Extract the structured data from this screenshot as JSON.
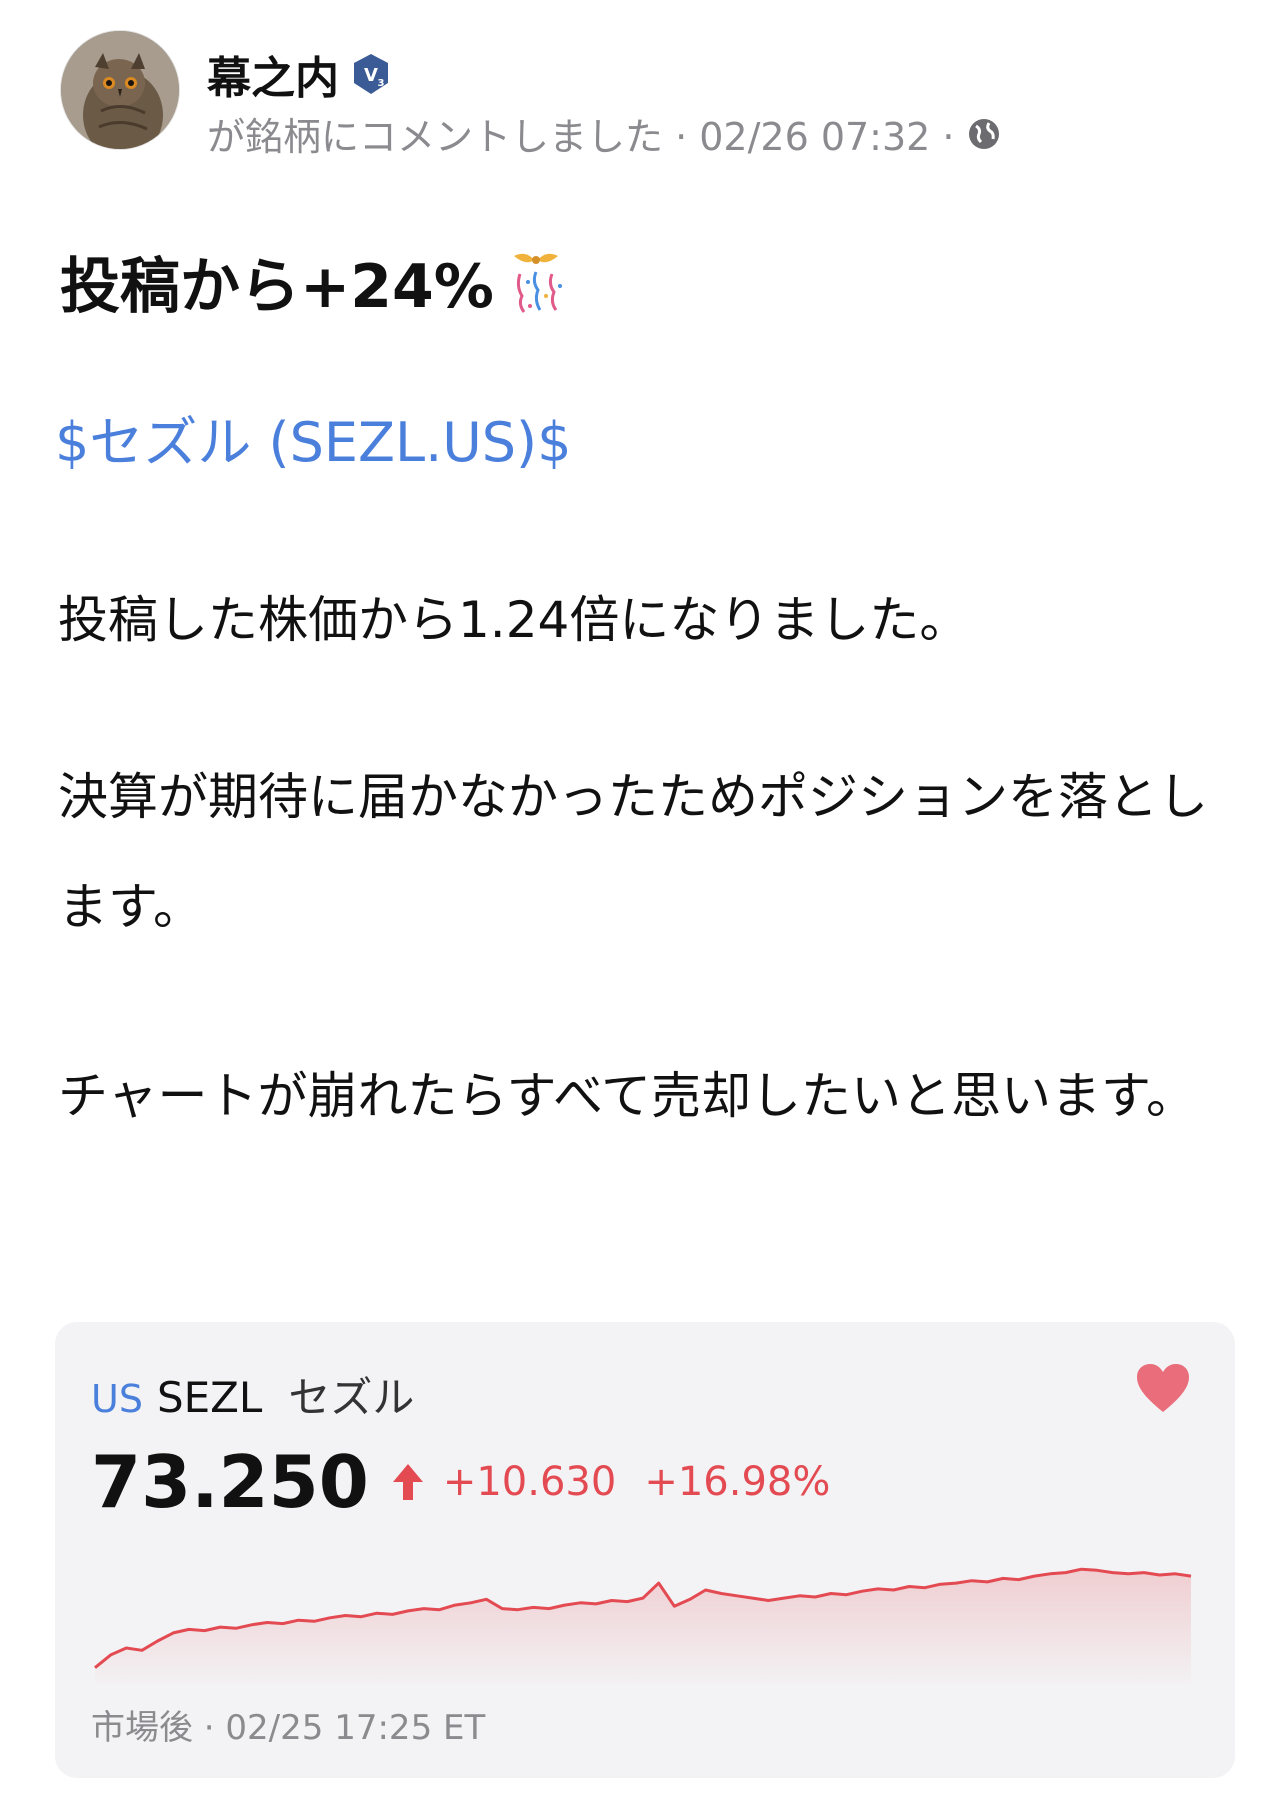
{
  "post": {
    "author": "幕之内",
    "badge_icon": "verified-v3-badge-icon",
    "meta_text": "が銘柄にコメントしました · 02/26 07:32 ·",
    "visibility_icon": "globe-icon",
    "headline": "投稿から+24%",
    "headline_icon": "party-popper-icon",
    "stock_link": "$セズル (SEZL.US)$",
    "paragraphs": [
      "投稿した株価から1.24倍になりました。",
      "決算が期待に届かなかったためポジションを落とします。",
      "チャートが崩れたらすべて売却したいと思います。"
    ]
  },
  "stock_card": {
    "market": "US",
    "symbol": "SEZL",
    "name": "セズル",
    "price": "73.250",
    "change": "+10.630",
    "change_pct": "+16.98%",
    "direction_icon": "up-arrow-icon",
    "favorite_icon": "heart-icon",
    "timestamp": "市場後 · 02/25 17:25 ET",
    "colors": {
      "up": "#e34a52",
      "link": "#4a7fdc",
      "card_bg": "#f3f3f5"
    }
  },
  "chart_data": {
    "type": "line",
    "x": [
      0,
      1,
      2,
      3,
      4,
      5,
      6,
      7,
      8,
      9,
      10,
      11,
      12,
      13,
      14,
      15,
      16,
      17,
      18,
      19,
      20,
      21,
      22,
      23,
      24,
      25,
      26,
      27,
      28,
      29,
      30,
      31,
      32,
      33,
      34,
      35,
      36,
      37,
      38,
      39,
      40,
      41,
      42,
      43,
      44,
      45,
      46,
      47,
      48,
      49,
      50,
      51,
      52,
      53,
      54,
      55,
      56,
      57,
      58,
      59,
      60,
      61,
      62,
      63,
      64,
      65,
      66,
      67,
      68,
      69,
      70
    ],
    "series": [
      {
        "values": [
          62.6,
          63.7,
          64.3,
          64.1,
          64.9,
          65.6,
          65.9,
          65.8,
          66.1,
          66.0,
          66.3,
          66.5,
          66.4,
          66.7,
          66.6,
          66.9,
          67.1,
          67.0,
          67.3,
          67.2,
          67.5,
          67.7,
          67.6,
          68.0,
          68.2,
          68.5,
          67.7,
          67.6,
          67.8,
          67.7,
          68.0,
          68.2,
          68.1,
          68.4,
          68.3,
          68.6,
          69.9,
          67.9,
          68.5,
          69.3,
          69.0,
          68.8,
          68.6,
          68.4,
          68.6,
          68.8,
          68.7,
          69.0,
          68.9,
          69.2,
          69.4,
          69.3,
          69.6,
          69.5,
          69.8,
          69.9,
          70.1,
          70.0,
          70.3,
          70.2,
          70.5,
          70.7,
          70.8,
          71.1,
          71.0,
          70.8,
          70.7,
          70.8,
          70.6,
          70.7,
          70.5
        ]
      }
    ],
    "grid": false
  }
}
